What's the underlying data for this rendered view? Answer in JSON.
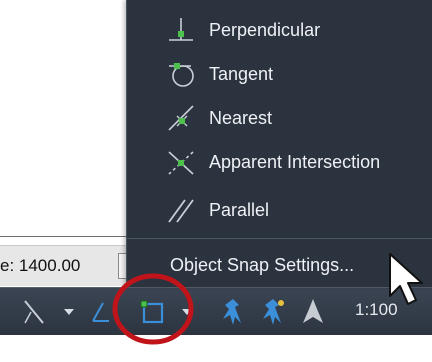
{
  "menu": {
    "items": [
      {
        "label": "Perpendicular",
        "icon": "perpendicular-snap-icon"
      },
      {
        "label": "Tangent",
        "icon": "tangent-snap-icon"
      },
      {
        "label": "Nearest",
        "icon": "nearest-snap-icon"
      },
      {
        "label": "Apparent Intersection",
        "icon": "apparent-intersection-snap-icon"
      },
      {
        "label": "Parallel",
        "icon": "parallel-snap-icon"
      }
    ],
    "settings_label": "Object Snap Settings..."
  },
  "fields": {
    "scale_value": "e: 1400.00"
  },
  "statusbar": {
    "annotation_scale": "1:100"
  },
  "colors": {
    "menu_bg": "#2b333e",
    "statusbar_bg": "#333c48",
    "snap_marker": "#4cc24c",
    "accent_blue": "#3b8ed8",
    "highlight_ring": "#c0141a"
  }
}
